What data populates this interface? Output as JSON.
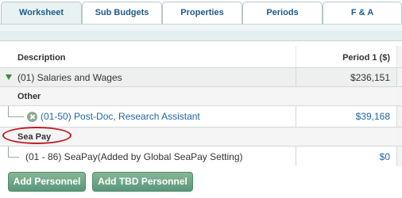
{
  "tabs": [
    {
      "label": "Worksheet",
      "active": true
    },
    {
      "label": "Sub Budgets",
      "active": false
    },
    {
      "label": "Properties",
      "active": false
    },
    {
      "label": "Periods",
      "active": false
    },
    {
      "label": "F & A",
      "active": false
    }
  ],
  "grid": {
    "header": {
      "description": "Description",
      "period": "Period 1 ($)"
    },
    "category": {
      "label": "(01) Salaries and Wages",
      "value": "$236,151",
      "expanded": true
    },
    "sections": [
      {
        "title": "Other",
        "items": [
          {
            "label": "(01-50) Post-Doc, Research Assistant",
            "value": "$39,168",
            "icon": "remove-icon"
          }
        ]
      },
      {
        "title": "Sea Pay",
        "highlighted": true,
        "items": [
          {
            "label": "(01 - 86) SeaPay(Added by Global SeaPay Setting)",
            "value": "$0"
          }
        ]
      }
    ]
  },
  "buttons": {
    "add_personnel": "Add Personnel",
    "add_tbd_personnel": "Add TBD Personnel"
  },
  "colors": {
    "link": "#2364a4",
    "tab_text": "#1d5a87",
    "button": "#6aa684",
    "expand": "#3b8a3b",
    "annotation": "#c01a22"
  }
}
